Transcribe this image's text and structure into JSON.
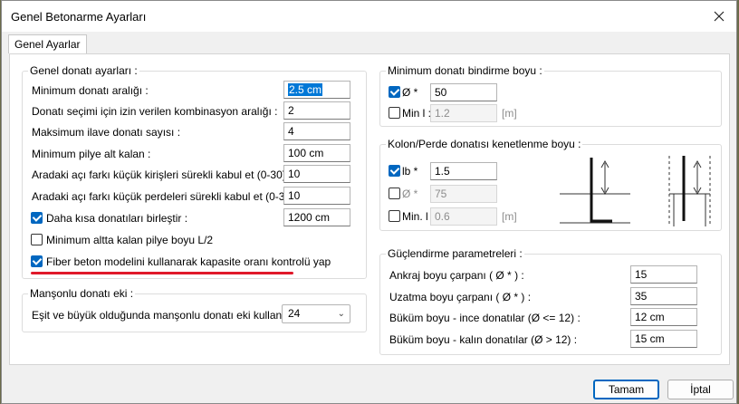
{
  "window": {
    "title": "Genel Betonarme Ayarları"
  },
  "tabs": [
    "Genel Ayarlar"
  ],
  "general": {
    "title": "Genel donatı ayarları :",
    "rows": [
      {
        "label": "Minimum donatı aralığı :",
        "value": "2.5 cm"
      },
      {
        "label": "Donatı seçimi için izin verilen kombinasyon aralığı :",
        "value": "2"
      },
      {
        "label": "Maksimum ilave donatı sayısı :",
        "value": "4"
      },
      {
        "label": "Minimum pilye alt kalan :",
        "value": "100 cm"
      },
      {
        "label": "Aradaki açı farkı küçük kirişleri sürekli kabul et (0-30) :",
        "value": "10"
      },
      {
        "label": "Aradaki açı farkı küçük perdeleri sürekli kabul et (0-30) :",
        "value": "10"
      }
    ],
    "join_short": {
      "label": "Daha kısa donatıları birleştir :",
      "value": "1200 cm",
      "checked": true
    },
    "min_bottom": {
      "label": "Minimum altta kalan pilye boyu L/2",
      "checked": false
    },
    "fiber": {
      "label": "Fiber beton modelini kullanarak kapasite oranı kontrolü yap",
      "checked": true
    }
  },
  "sleeve": {
    "title": "Manşonlu donatı eki :",
    "label": "Eşit ve büyük olduğunda manşonlu donatı eki kullan :",
    "value": "24"
  },
  "lap": {
    "title": "Minimum donatı bindirme boyu :",
    "phi": {
      "label": "Ø *",
      "value": "50",
      "checked": true
    },
    "min": {
      "label": "Min l :",
      "value": "1.2",
      "unit": "[m]",
      "checked": false
    }
  },
  "anchor": {
    "title": "Kolon/Perde donatısı kenetlenme boyu :",
    "lb": {
      "label": "lb *",
      "value": "1.5",
      "checked": true
    },
    "phi": {
      "label": "Ø *",
      "value": "75",
      "checked": false
    },
    "min": {
      "label": "Min. l",
      "value": "0.6",
      "unit": "[m]",
      "checked": false
    }
  },
  "strength": {
    "title": "Güçlendirme parametreleri :",
    "rows": [
      {
        "label": "Ankraj boyu çarpanı  ( Ø * ) :",
        "value": "15"
      },
      {
        "label": "Uzatma boyu çarpanı  ( Ø * ) :",
        "value": "35"
      },
      {
        "label": "Büküm boyu - ince donatılar (Ø <= 12) :",
        "value": "12 cm"
      },
      {
        "label": "Büküm boyu - kalın donatılar (Ø > 12) :",
        "value": "15 cm"
      }
    ]
  },
  "buttons": {
    "ok": "Tamam",
    "cancel": "İptal"
  },
  "colors": {
    "accent": "#0067c0",
    "annotation": "#e0192a"
  }
}
